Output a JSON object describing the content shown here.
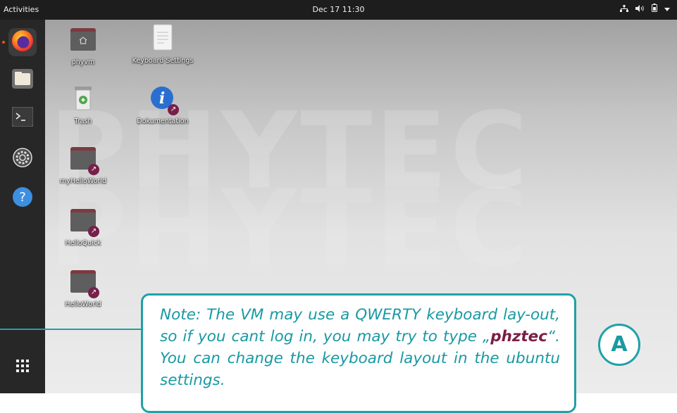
{
  "topbar": {
    "activities": "Activities",
    "clock": "Dec 17  11:30",
    "tray_icons": [
      "network-icon",
      "volume-icon",
      "battery-icon",
      "menu-arrow-icon"
    ]
  },
  "dock": {
    "items": [
      {
        "name": "Firefox",
        "icon": "firefox-icon",
        "running": true
      },
      {
        "name": "Files",
        "icon": "files-icon",
        "running": false
      },
      {
        "name": "Terminal",
        "icon": "terminal-icon",
        "running": false
      },
      {
        "name": "Settings",
        "icon": "settings-icon",
        "running": false
      },
      {
        "name": "Help",
        "icon": "help-icon",
        "running": false
      }
    ],
    "show_apps_icon": "app-grid-icon"
  },
  "desktop": {
    "watermark": "PHYTEC",
    "icons": [
      {
        "label": "phyvm",
        "icon": "home-folder-icon"
      },
      {
        "label": "Keyboard Settings",
        "icon": "document-icon"
      },
      {
        "label": "Trash",
        "icon": "trash-icon"
      },
      {
        "label": "Dokumentation",
        "icon": "info-icon"
      },
      {
        "label": "myHelloWorld",
        "icon": "folder-link-icon"
      },
      {
        "label": "HelloQuick",
        "icon": "folder-link-icon"
      },
      {
        "label": "HelloWorld",
        "icon": "folder-link-icon"
      }
    ]
  },
  "note": {
    "text_before": "Note: The VM may use a QWERTY keyboard lay-out, so if you cant log in, you may try to type „",
    "highlight": "phztec",
    "text_after": "“. You can change the keyboard layout in the ubuntu settings."
  },
  "marker": "A",
  "colors": {
    "accent": "#1899a3",
    "highlight": "#7a1e44",
    "topbar": "#1d1d1d",
    "dock": "#272727"
  }
}
